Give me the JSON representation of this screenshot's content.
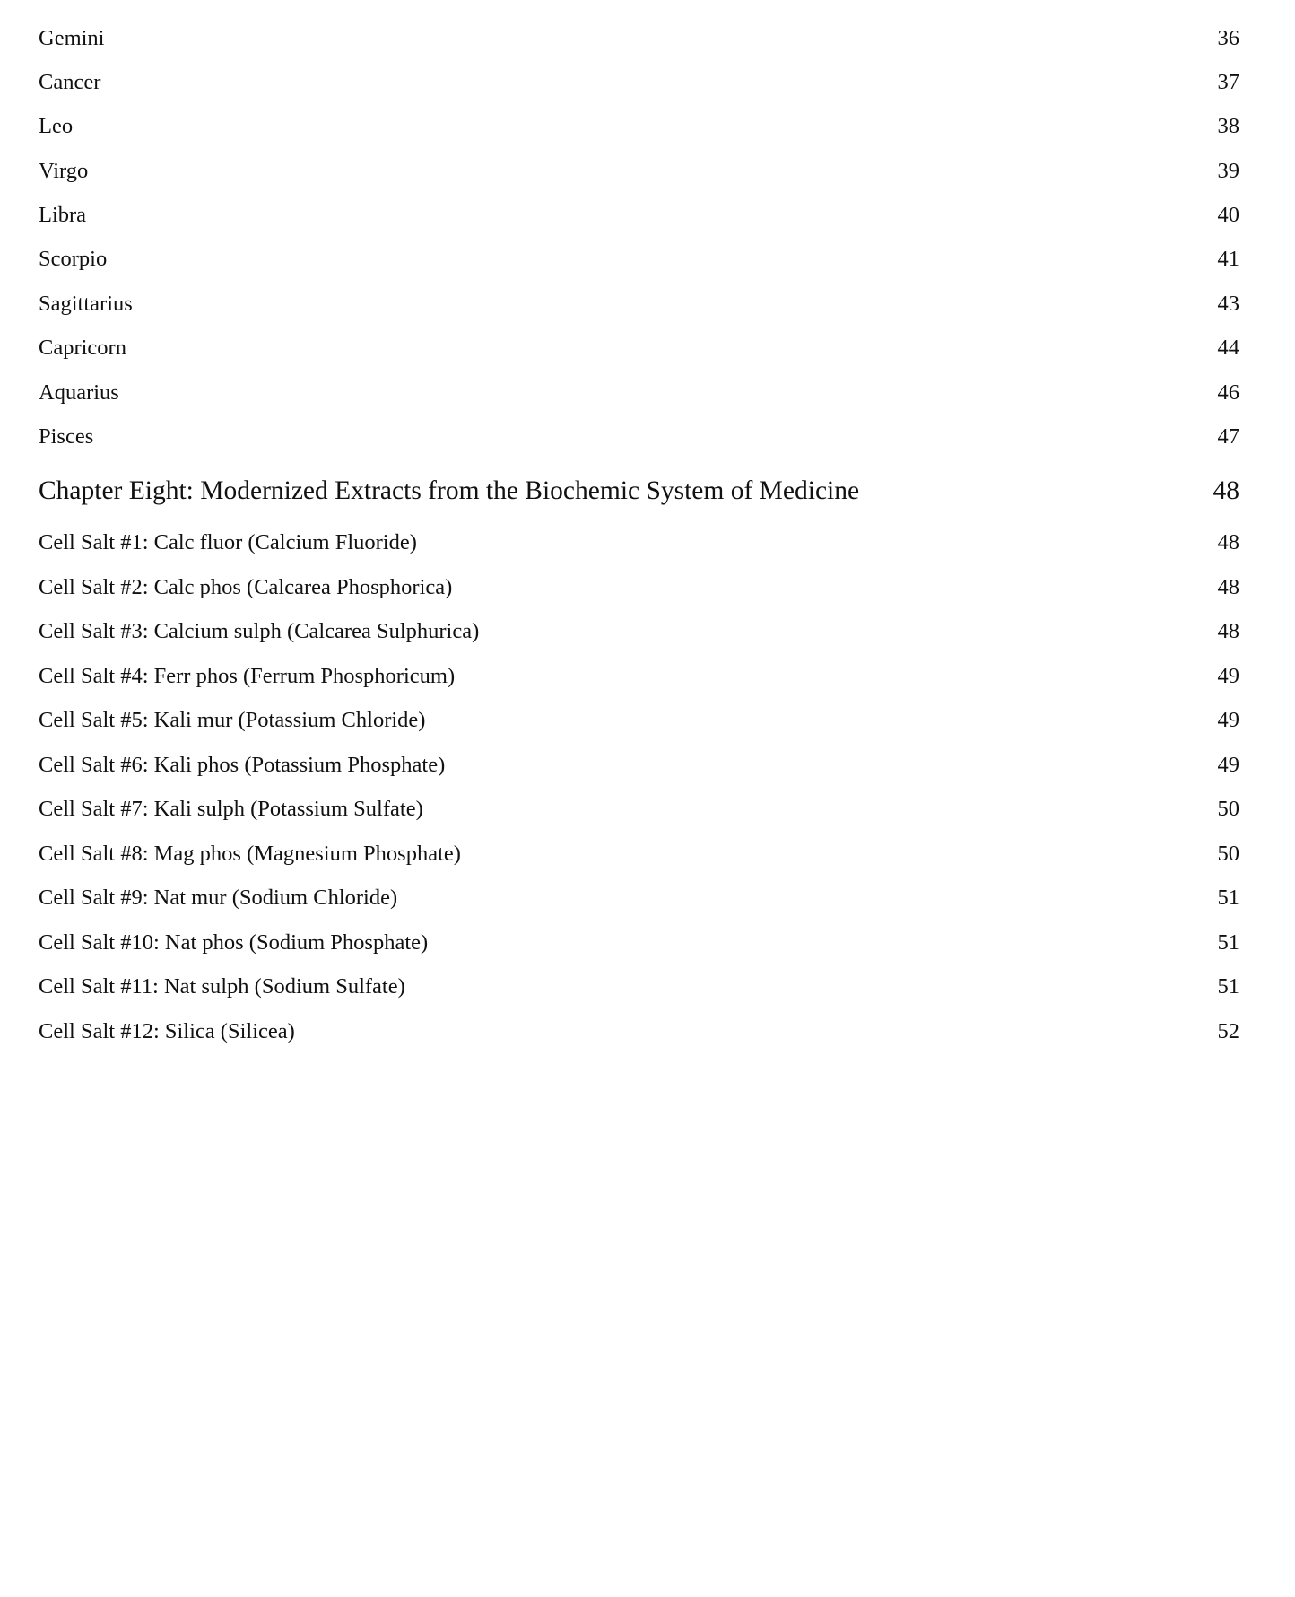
{
  "toc": {
    "signs": [
      {
        "label": "Gemini",
        "page": "36"
      },
      {
        "label": "Cancer",
        "page": "37"
      },
      {
        "label": "Leo",
        "page": "38"
      },
      {
        "label": "Virgo",
        "page": "39"
      },
      {
        "label": "Libra",
        "page": "40"
      },
      {
        "label": "Scorpio",
        "page": "41"
      },
      {
        "label": "Sagittarius",
        "page": "43"
      },
      {
        "label": "Capricorn",
        "page": "44"
      },
      {
        "label": "Aquarius",
        "page": "46"
      },
      {
        "label": "Pisces",
        "page": "47"
      }
    ],
    "chapter": {
      "label": "Chapter Eight: Modernized Extracts from the Biochemic System of Medicine",
      "page": "48"
    },
    "cell_salts": [
      {
        "label": "Cell Salt #1: Calc fluor (Calcium Fluoride)",
        "page": "48"
      },
      {
        "label": "Cell Salt #2: Calc phos (Calcarea Phosphorica)",
        "page": "48"
      },
      {
        "label": "Cell Salt #3: Calcium sulph (Calcarea Sulphurica)",
        "page": "48"
      },
      {
        "label": "Cell Salt #4: Ferr phos (Ferrum Phosphoricum)",
        "page": "49"
      },
      {
        "label": "Cell Salt #5: Kali mur (Potassium Chloride)",
        "page": "49"
      },
      {
        "label": "Cell Salt #6: Kali phos (Potassium Phosphate)",
        "page": "49"
      },
      {
        "label": "Cell Salt #7: Kali sulph (Potassium Sulfate)",
        "page": "50"
      },
      {
        "label": "Cell Salt #8: Mag phos (Magnesium Phosphate)",
        "page": "50"
      },
      {
        "label": "Cell Salt #9: Nat mur (Sodium Chloride)",
        "page": "51"
      },
      {
        "label": "Cell Salt #10: Nat phos (Sodium Phosphate)",
        "page": "51"
      },
      {
        "label": "Cell Salt #11: Nat sulph (Sodium Sulfate)",
        "page": "51"
      },
      {
        "label": "Cell Salt #12: Silica (Silicea)",
        "page": "52"
      }
    ]
  }
}
